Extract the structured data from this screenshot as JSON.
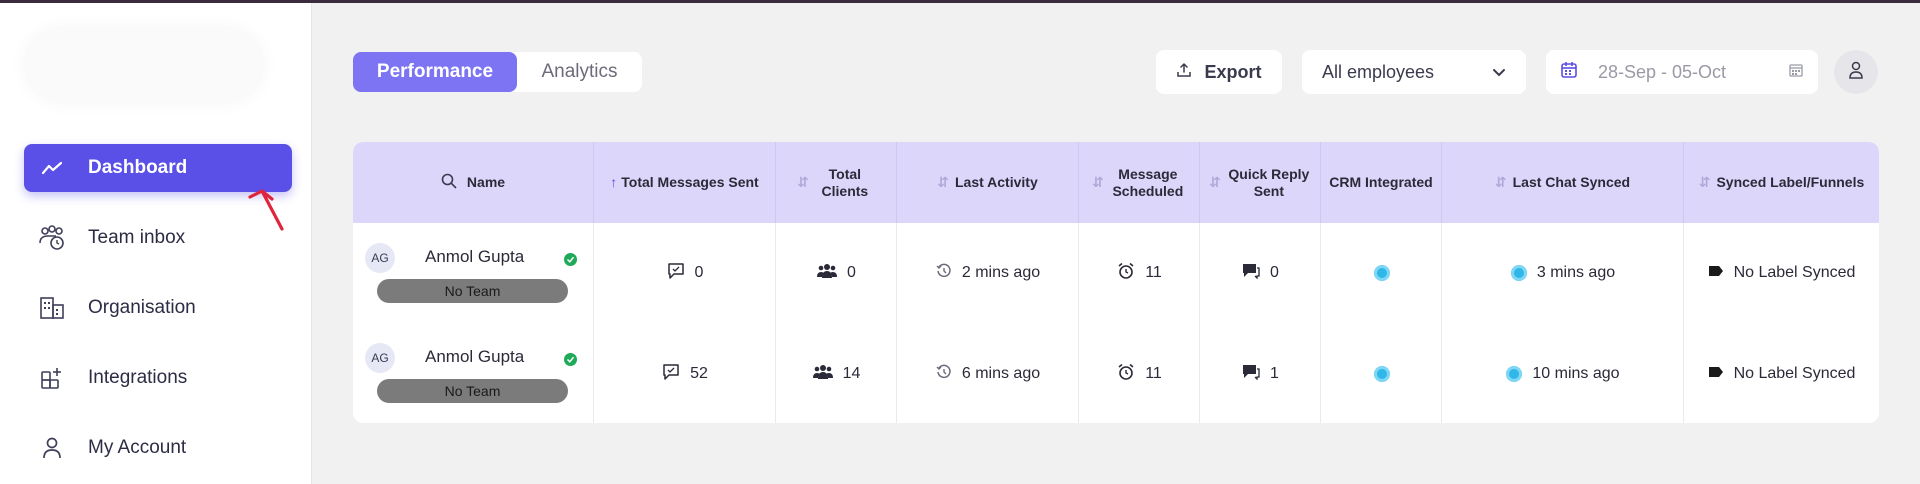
{
  "sidebar": {
    "items": [
      {
        "label": "Dashboard",
        "icon": "trend-icon",
        "active": true
      },
      {
        "label": "Team inbox",
        "icon": "team-chat-icon",
        "active": false
      },
      {
        "label": "Organisation",
        "icon": "building-icon",
        "active": false
      },
      {
        "label": "Integrations",
        "icon": "add-grid-icon",
        "active": false
      },
      {
        "label": "My Account",
        "icon": "user-icon",
        "active": false
      }
    ]
  },
  "toolbar": {
    "tabs": [
      {
        "label": "Performance",
        "active": true
      },
      {
        "label": "Analytics",
        "active": false
      }
    ],
    "export_label": "Export",
    "employee_filter": "All employees",
    "date_range": "28-Sep - 05-Oct"
  },
  "table": {
    "columns": [
      "Name",
      "Total Messages Sent",
      "Total Clients",
      "Last Activity",
      "Message Scheduled",
      "Quick Reply Sent",
      "CRM Integrated",
      "Last Chat Synced",
      "Synced Label/Funnels"
    ],
    "rows": [
      {
        "initials": "AG",
        "name": "Anmol Gupta",
        "team": "No Team",
        "messages": "0",
        "clients": "0",
        "last_activity": "2 mins ago",
        "scheduled": "11",
        "quick_reply": "0",
        "last_chat": "3 mins ago",
        "label": "No Label Synced"
      },
      {
        "initials": "AG",
        "name": "Anmol Gupta",
        "team": "No Team",
        "messages": "52",
        "clients": "14",
        "last_activity": "6 mins ago",
        "scheduled": "11",
        "quick_reply": "1",
        "last_chat": "10 mins ago",
        "label": "No Label Synced"
      }
    ]
  },
  "colors": {
    "accent": "#5a4fe6",
    "tab_active": "#7c74f2",
    "header_bg": "#ddd6fb",
    "page_bg": "#f2f1f1",
    "status_green": "#1faa5a",
    "crm_blue": "#2fb7e8"
  }
}
